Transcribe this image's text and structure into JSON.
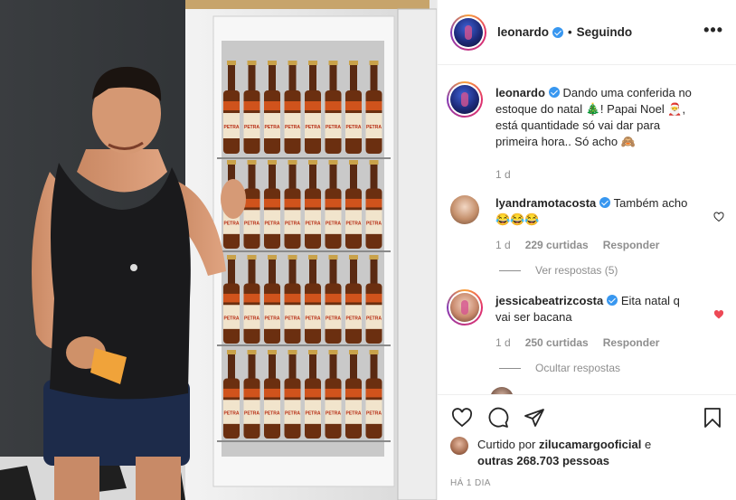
{
  "header": {
    "username": "leonardo",
    "follow_state": "Seguindo",
    "more": "•••"
  },
  "caption": {
    "username": "leonardo",
    "text": "Dando uma conferida no estoque do natal 🎄! Papai Noel 🎅, está quantidade só vai dar para primeira hora.. Só acho 🙈",
    "time": "1 d"
  },
  "comments": [
    {
      "username": "lyandramotacosta",
      "text": "Também acho 😂😂😂",
      "time": "1 d",
      "likes": "229 curtidas",
      "reply": "Responder",
      "replies_link": "Ver respostas (5)",
      "liked": false
    },
    {
      "username": "jessicabeatrizcosta",
      "text": "Eita natal q vai ser bacana",
      "time": "1 d",
      "likes": "250 curtidas",
      "reply": "Responder",
      "replies_link": "Ocultar respostas",
      "liked": true
    }
  ],
  "likes": {
    "prefix": "Curtido por",
    "user": "zilucamargooficial",
    "and": "e",
    "others": "outras 268.703 pessoas"
  },
  "post_time": "Há 1 dia",
  "photo": {
    "brand": "PETRA"
  },
  "colors": {
    "verified": "#3897f0",
    "heart_red": "#ed4956",
    "muted": "#8e8e8e"
  }
}
